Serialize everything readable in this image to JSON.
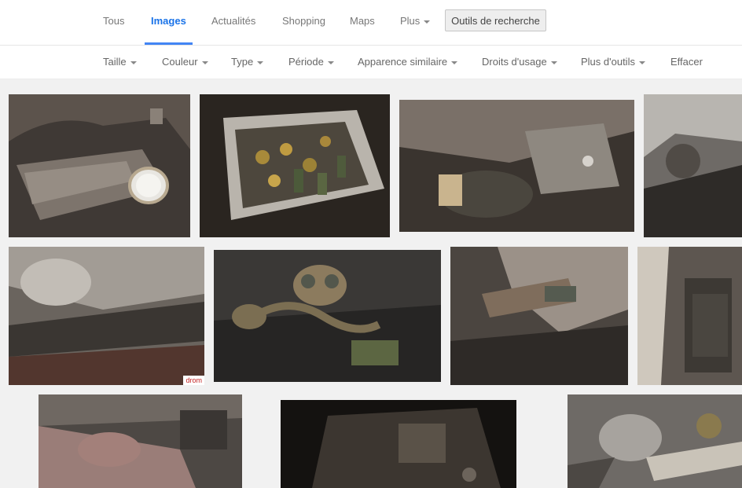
{
  "tabs": [
    {
      "label": "Tous"
    },
    {
      "label": "Images"
    },
    {
      "label": "Actualités"
    },
    {
      "label": "Shopping"
    },
    {
      "label": "Maps"
    },
    {
      "label": "Plus"
    }
  ],
  "active_tab": "Images",
  "search_tools_label": "Outils de recherche",
  "filters": [
    {
      "label": "Taille"
    },
    {
      "label": "Couleur"
    },
    {
      "label": "Type"
    },
    {
      "label": "Période"
    },
    {
      "label": "Apparence similaire"
    },
    {
      "label": "Droits d'usage"
    },
    {
      "label": "Plus d'outils"
    },
    {
      "label": "Effacer"
    }
  ],
  "watermark_text": "drom",
  "colors": {
    "active_tab": "#1a73e8",
    "active_underline": "#4285f4",
    "tab_text": "#777777",
    "page_background": "#f1f1f1"
  },
  "icons": [
    "dropdown-caret-icon"
  ]
}
